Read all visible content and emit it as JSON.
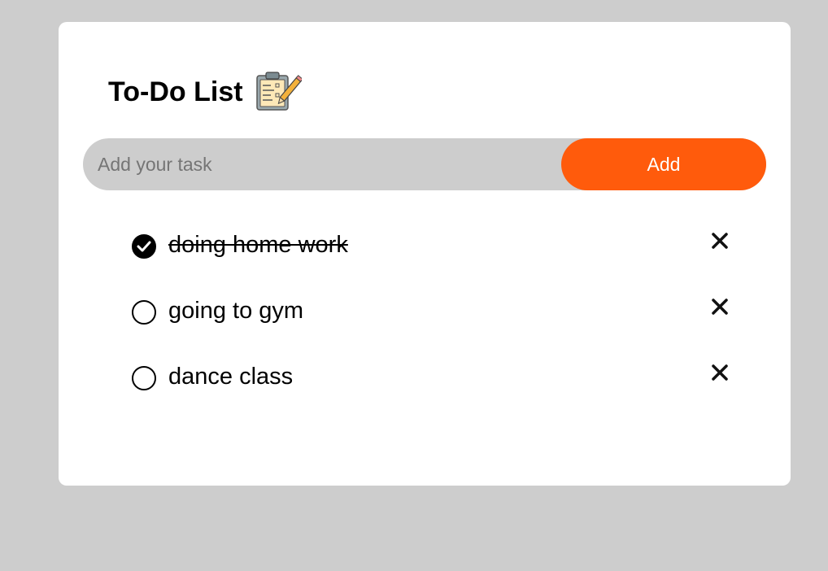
{
  "app": {
    "title": "To-Do List",
    "title_icon": "clipboard-checklist-icon"
  },
  "input": {
    "placeholder": "Add your task",
    "value": ""
  },
  "add_button": {
    "label": "Add"
  },
  "tasks": [
    {
      "text": "doing home work",
      "done": true
    },
    {
      "text": "going to gym",
      "done": false
    },
    {
      "text": "dance class",
      "done": false
    }
  ],
  "colors": {
    "background": "#cdcdcd",
    "card": "#ffffff",
    "accent": "#ff5b0c",
    "input_bg": "#cdcdcd"
  },
  "icons": {
    "checked": "checked-circle-icon",
    "unchecked": "unchecked-circle-icon",
    "delete": "close-icon"
  }
}
